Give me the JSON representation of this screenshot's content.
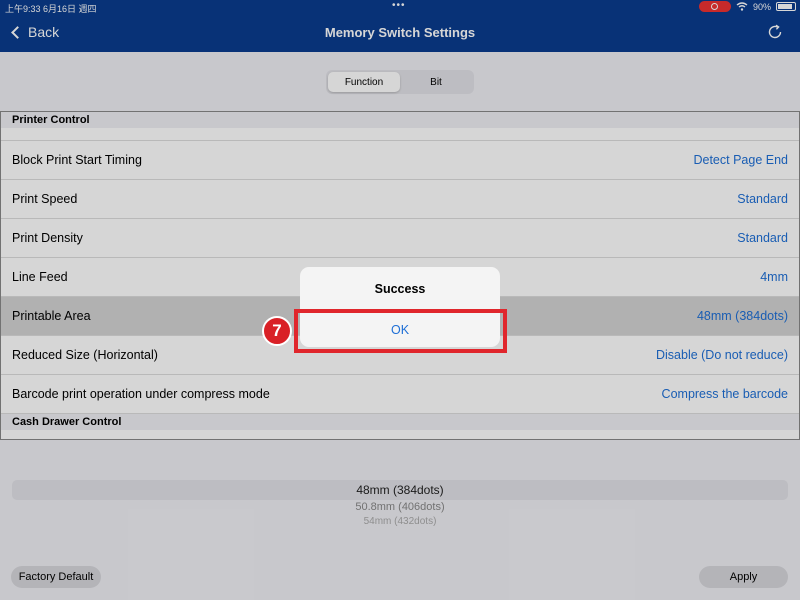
{
  "status_bar": {
    "time_date": "上午9:33  6月16日 週四",
    "battery": "90%",
    "dots": "•••"
  },
  "nav": {
    "back_label": "Back",
    "title": "Memory Switch Settings",
    "refresh_icon": "refresh-icon"
  },
  "segments": [
    {
      "label": "Function",
      "selected": true
    },
    {
      "label": "Bit",
      "selected": false
    }
  ],
  "sections": {
    "printer_control": "Printer Control",
    "cash_drawer_control": "Cash Drawer Control"
  },
  "rows": [
    {
      "label": "Block Print Start Timing",
      "value": "Detect Page End"
    },
    {
      "label": "Print Speed",
      "value": "Standard"
    },
    {
      "label": "Print Density",
      "value": "Standard"
    },
    {
      "label": "Line Feed",
      "value": "4mm"
    },
    {
      "label": "Printable Area",
      "value": "48mm (384dots)",
      "selected": true
    },
    {
      "label": "Reduced Size (Horizontal)",
      "value": "Disable (Do not reduce)"
    },
    {
      "label": "Barcode print operation under compress mode",
      "value": "Compress the barcode"
    }
  ],
  "picker": {
    "options": [
      "48mm (384dots)",
      "50.8mm (406dots)",
      "54mm (432dots)"
    ],
    "selected": "48mm (384dots)"
  },
  "buttons": {
    "factory_default": "Factory Default",
    "apply": "Apply"
  },
  "alert": {
    "title": "Success",
    "ok_label": "OK"
  },
  "annotation": {
    "step_number": "7",
    "color": "#e0262c"
  },
  "colors": {
    "nav_bar": "#0a3c8e",
    "value_text": "#1e6fd6",
    "selected_row": "#d3d3d3"
  }
}
